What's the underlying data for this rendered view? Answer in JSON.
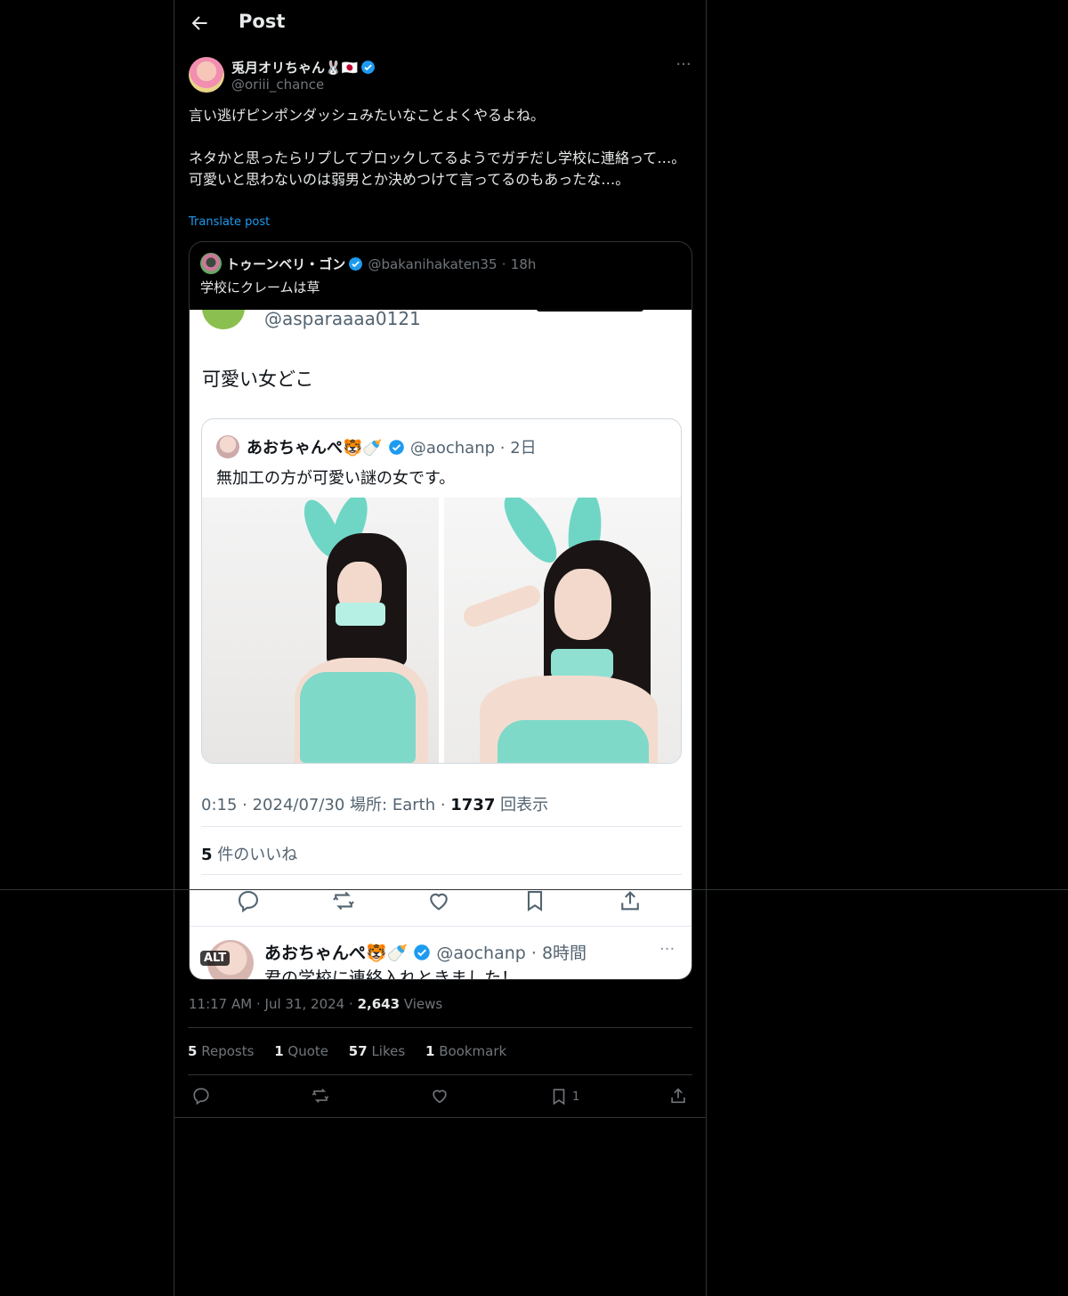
{
  "header": {
    "title": "Post"
  },
  "author": {
    "name": "兎月オリちゃん🐰🇯🇵",
    "handle": "@oriii_chance"
  },
  "post": {
    "line1": "言い逃げピンポンダッシュみたいなことよくやるよね。",
    "line2": "ネタかと思ったらリプしてブロックしてるようでガチだし学校に連絡って…。可愛いと思わないのは弱男とか決めつけて言ってるのもあったな…。",
    "translate": "Translate post"
  },
  "quote": {
    "name": "トゥーンベリ・ゴン",
    "handle": "@bakanihakaten35",
    "sep": "·",
    "time": "18h",
    "text": "学校にクレームは草",
    "image": {
      "handle_top": "@asparaaaa0121",
      "text1": "可愛い女どこ",
      "inner_name": "あおちゃんぺ🐯🍼",
      "inner_handle": "@aochanp · 2日",
      "inner_text": "無加工の方が可愛い謎の女です。",
      "meta_pre": "0:15 · 2024/07/30 場所: Earth · ",
      "meta_views": "1737",
      "meta_views_label": " 回表示",
      "likes_num": "5",
      "likes_label": " 件のいいね",
      "reply_name": "あおちゃんぺ🐯🍼",
      "reply_handle": "@aochanp · 8時間",
      "reply_text": "君の学校に連絡入れときました！",
      "alt_badge": "ALT"
    }
  },
  "meta": {
    "time": "11:17 AM",
    "dot": "·",
    "date": "Jul 31, 2024",
    "views_num": "2,643",
    "views_label": "Views"
  },
  "stats": {
    "reposts_num": "5",
    "reposts_label": "Reposts",
    "quotes_num": "1",
    "quotes_label": "Quote",
    "likes_num": "57",
    "likes_label": "Likes",
    "bookmarks_num": "1",
    "bookmarks_label": "Bookmark"
  },
  "actions": {
    "bookmark_count": "1",
    "icons": [
      "reply-icon",
      "repost-icon",
      "like-icon",
      "bookmark-icon",
      "share-icon"
    ]
  },
  "colors": {
    "accent": "#1d9bf0",
    "muted": "#71767b",
    "border": "#2f3336",
    "bunny_teal": "#6fd6c5"
  }
}
